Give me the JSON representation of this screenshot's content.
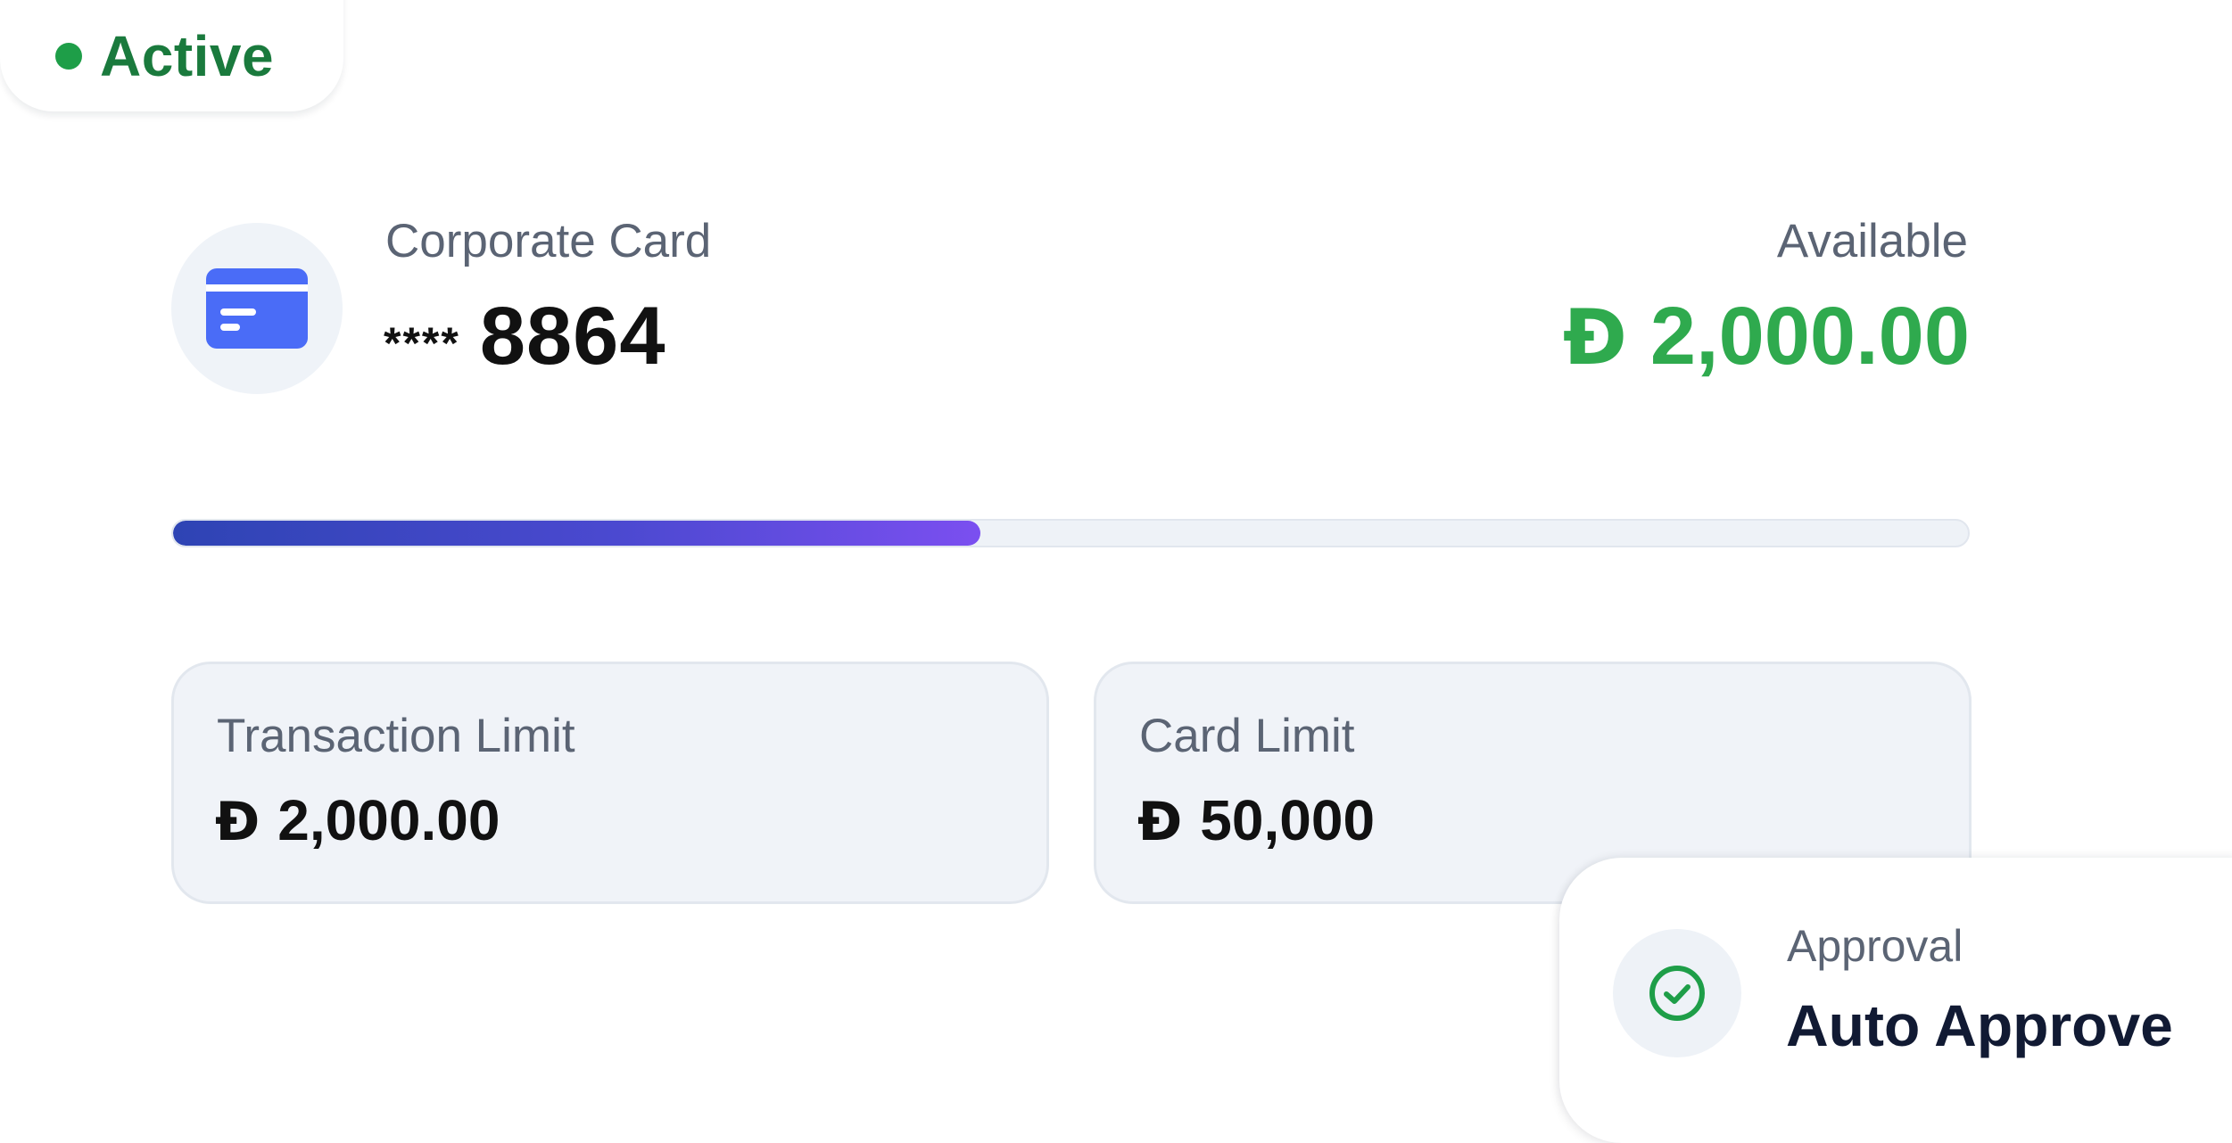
{
  "status": {
    "label": "Active",
    "color": "#1e9e48",
    "icon": "status-dot-icon"
  },
  "card": {
    "title": "Corporate Card",
    "mask": "****",
    "last4": "8864",
    "icon": "credit-card-icon",
    "icon_color": "#4a6cf7"
  },
  "available": {
    "label": "Available",
    "currency": "Ð",
    "amount": "2,000.00",
    "color": "#2faa4e"
  },
  "progress": {
    "fraction": 0.45,
    "gradient": [
      "#2e44b4",
      "#7b4ff0"
    ]
  },
  "limits": {
    "transaction": {
      "label": "Transaction Limit",
      "currency": "Ð",
      "amount": "2,000.00"
    },
    "card": {
      "label": "Card Limit",
      "currency": "Ð",
      "amount": "50,000"
    }
  },
  "approval": {
    "label": "Approval",
    "value": "Auto Approve",
    "icon": "check-circle-icon",
    "icon_color": "#1e9e48"
  }
}
